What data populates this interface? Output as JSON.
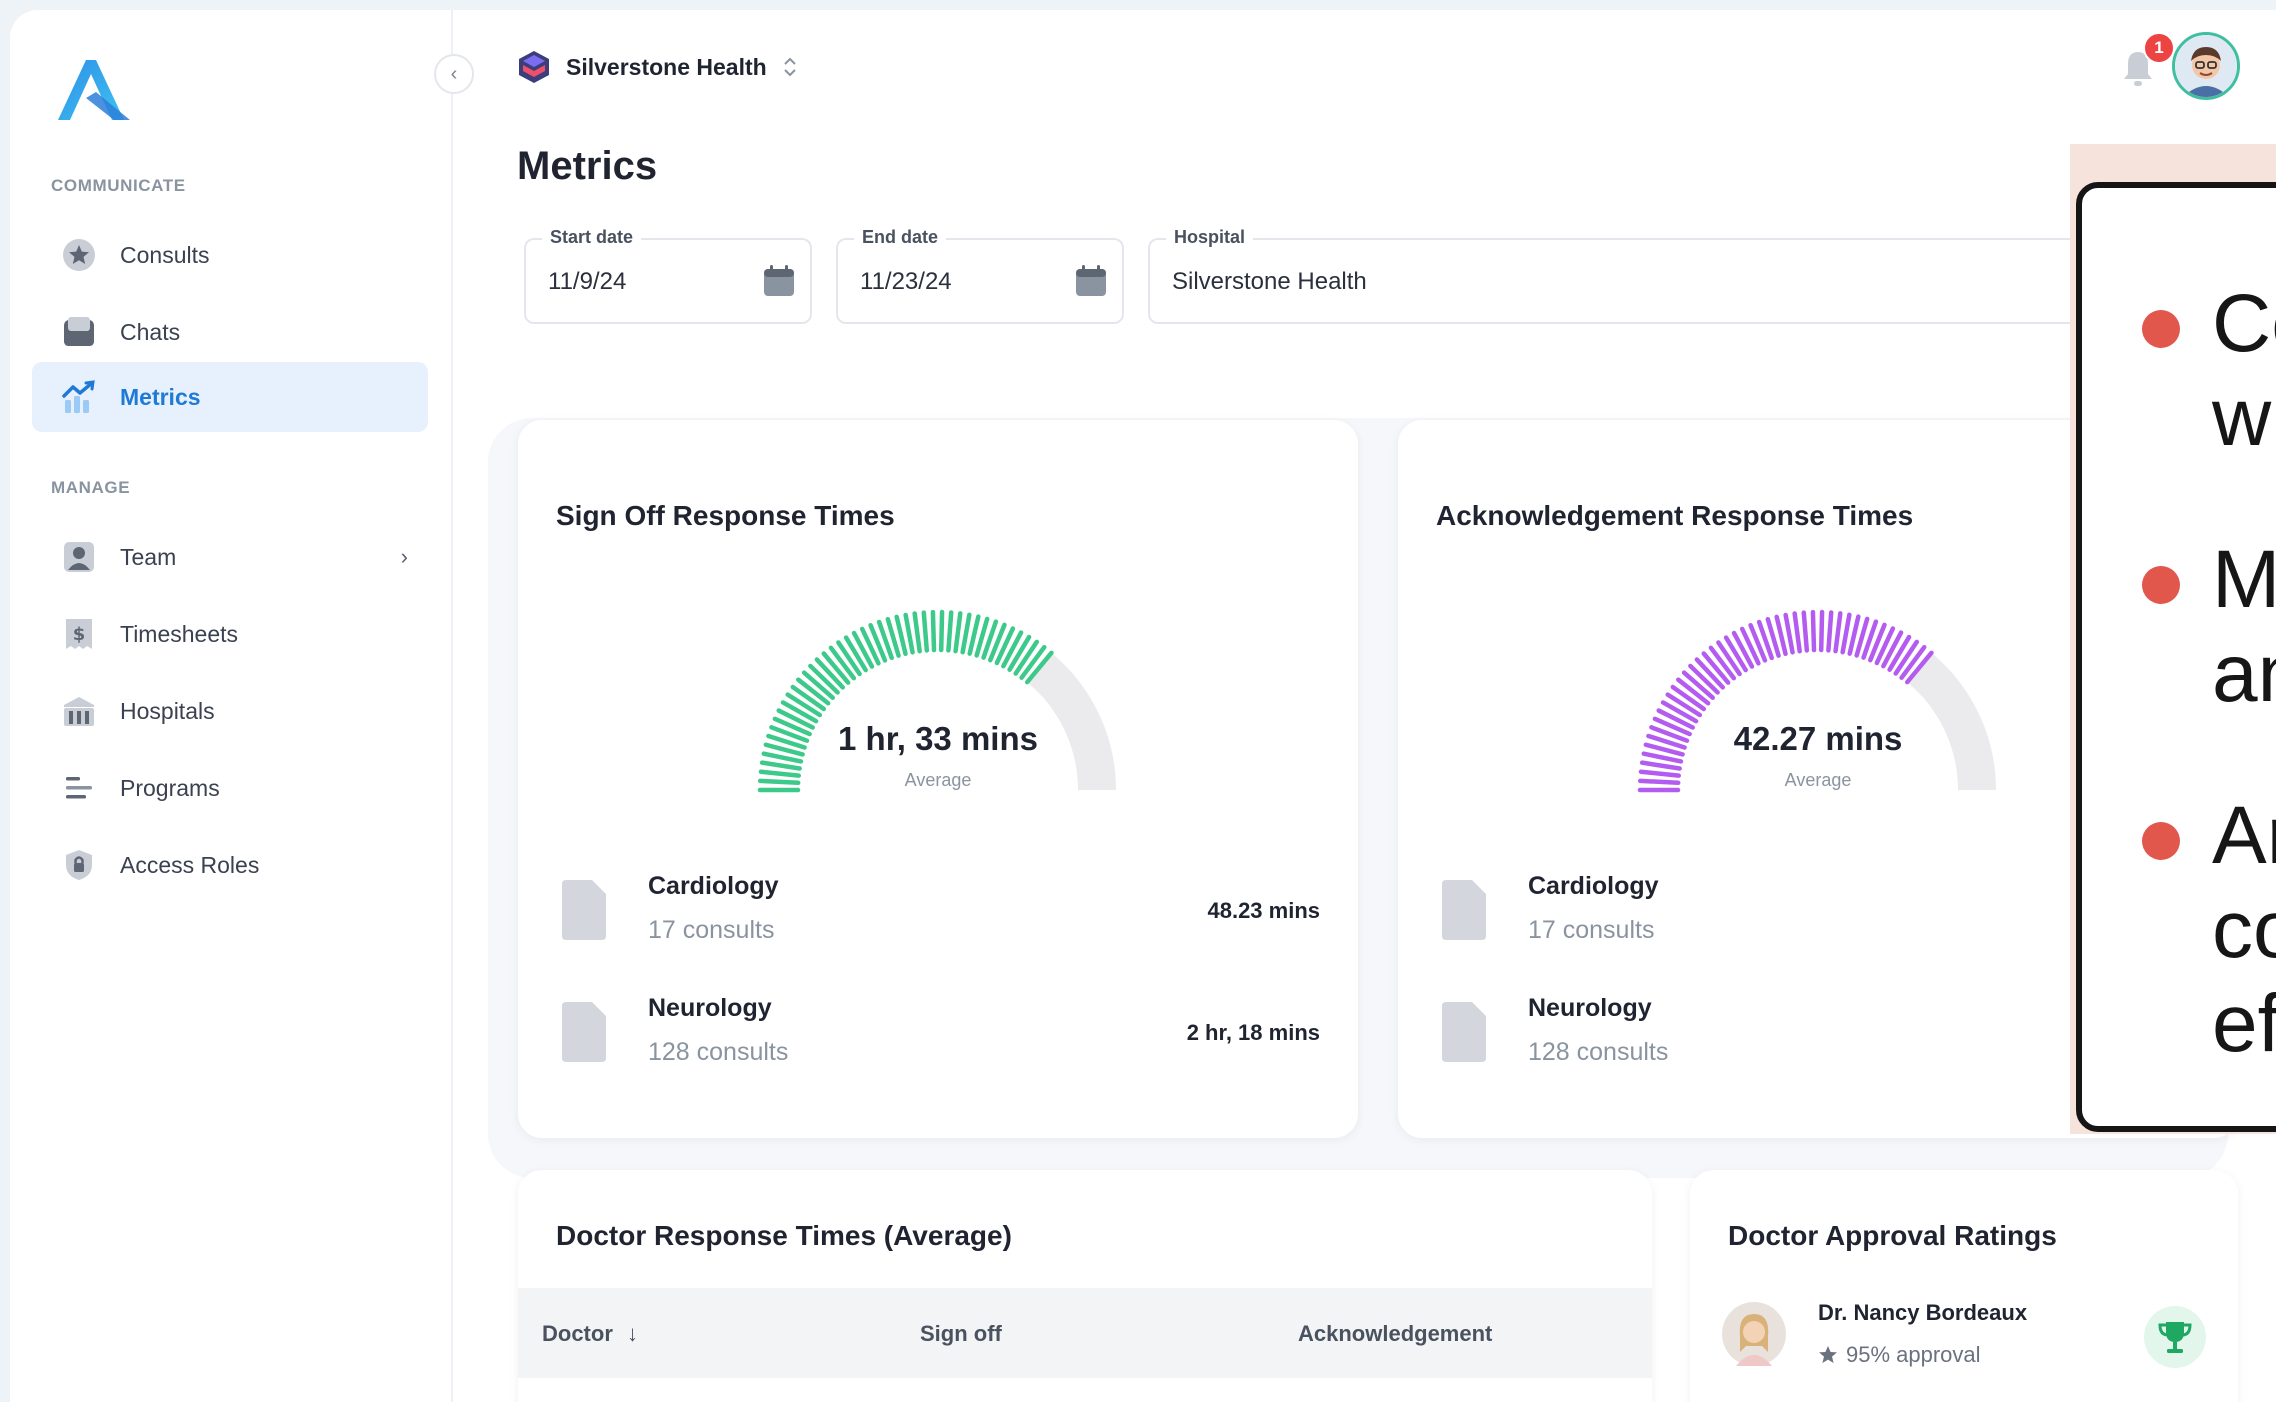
{
  "sidebar": {
    "sections": [
      {
        "label": "COMMUNICATE"
      },
      {
        "label": "MANAGE"
      }
    ],
    "items": [
      {
        "label": "Consults",
        "icon": "star-icon"
      },
      {
        "label": "Chats",
        "icon": "inbox-icon"
      },
      {
        "label": "Metrics",
        "icon": "chart-icon",
        "active": true
      },
      {
        "label": "Team",
        "icon": "person-icon"
      },
      {
        "label": "Timesheets",
        "icon": "dollar-doc-icon"
      },
      {
        "label": "Hospitals",
        "icon": "building-icon"
      },
      {
        "label": "Programs",
        "icon": "list-icon"
      },
      {
        "label": "Access Roles",
        "icon": "lock-icon"
      }
    ],
    "collapse_glyph": "‹",
    "chevron_glyph": "›"
  },
  "topbar": {
    "org_name": "Silverstone Health",
    "notification_count": "1"
  },
  "page": {
    "title": "Metrics"
  },
  "filters": {
    "start_date": {
      "label": "Start date",
      "value": "11/9/24"
    },
    "end_date": {
      "label": "End date",
      "value": "11/23/24"
    },
    "hospital": {
      "label": "Hospital",
      "value": "Silverstone Health"
    }
  },
  "sign_off": {
    "title": "Sign Off Response Times",
    "value": "1 hr, 33 mins",
    "caption": "Average",
    "fill_fraction": 0.72,
    "color": "#3dc98a",
    "rows": [
      {
        "name": "Cardiology",
        "count": "17 consults",
        "value": "48.23 mins"
      },
      {
        "name": "Neurology",
        "count": "128 consults",
        "value": "2 hr, 18 mins"
      }
    ]
  },
  "acknowledgement": {
    "title": "Acknowledgement Response Times",
    "value": "42.27 mins",
    "caption": "Average",
    "fill_fraction": 0.72,
    "color": "#b45cf0",
    "rows": [
      {
        "name": "Cardiology",
        "count": "17 consults"
      },
      {
        "name": "Neurology",
        "count": "128 consults"
      }
    ]
  },
  "doctor_table": {
    "title": "Doctor Response Times (Average)",
    "columns": [
      "Doctor",
      "Sign off",
      "Acknowledgement"
    ],
    "sort_glyph": "↓"
  },
  "ratings": {
    "title": "Doctor Approval Ratings",
    "doctors": [
      {
        "name": "Dr. Nancy Bordeaux",
        "approval": "95% approval"
      }
    ]
  },
  "overlay": {
    "lines": [
      "Co",
      "wi",
      "Mo",
      "an",
      "Ar",
      "co",
      "eff"
    ],
    "accent": "#e2574c"
  },
  "colors": {
    "brand": "#1f7ad6",
    "gauge_track": "#ebebee"
  }
}
